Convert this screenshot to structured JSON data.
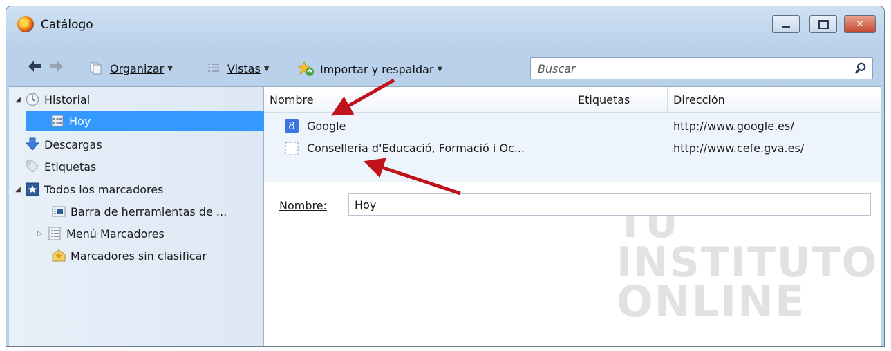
{
  "window": {
    "title": "Catálogo",
    "buttons": {
      "minimize": "",
      "maximize": "",
      "close": "✕"
    }
  },
  "toolbar": {
    "back_icon": "arrow-left-icon",
    "forward_icon": "arrow-right-icon",
    "organize": "Organizar",
    "views": "Vistas",
    "import_backup": "Importar y respaldar",
    "search_placeholder": "Buscar"
  },
  "sidebar": {
    "items": [
      {
        "label": "Historial",
        "icon": "clock-icon"
      },
      {
        "label": "Hoy",
        "icon": "calendar-icon",
        "selected": true
      },
      {
        "label": "Descargas",
        "icon": "download-icon"
      },
      {
        "label": "Etiquetas",
        "icon": "tag-icon"
      },
      {
        "label": "Todos los marcadores",
        "icon": "bookmarks-star-icon"
      },
      {
        "label": "Barra de herramientas de ...",
        "icon": "toolbar-icon"
      },
      {
        "label": "Menú Marcadores",
        "icon": "menu-list-icon"
      },
      {
        "label": "Marcadores sin clasificar",
        "icon": "unsorted-bookmarks-icon"
      }
    ]
  },
  "table": {
    "columns": [
      "Nombre",
      "Etiquetas",
      "Dirección"
    ],
    "rows": [
      {
        "name": "Google",
        "tags": "",
        "url": "http://www.google.es/",
        "favicon": "google-favicon"
      },
      {
        "name": "Conselleria d'Educació, Formació i Oc...",
        "tags": "",
        "url": "http://www.cefe.gva.es/",
        "favicon": "blank-page-icon"
      }
    ]
  },
  "details": {
    "name_label": "Nombre:",
    "name_value": "Hoy"
  },
  "watermark": {
    "line1": "TU",
    "line2": "INSTITUTO",
    "line3": "ONLINE"
  },
  "colors": {
    "selection": "#3399ff",
    "annotation_arrow": "#c0141c",
    "close_button": "#c4472f"
  }
}
